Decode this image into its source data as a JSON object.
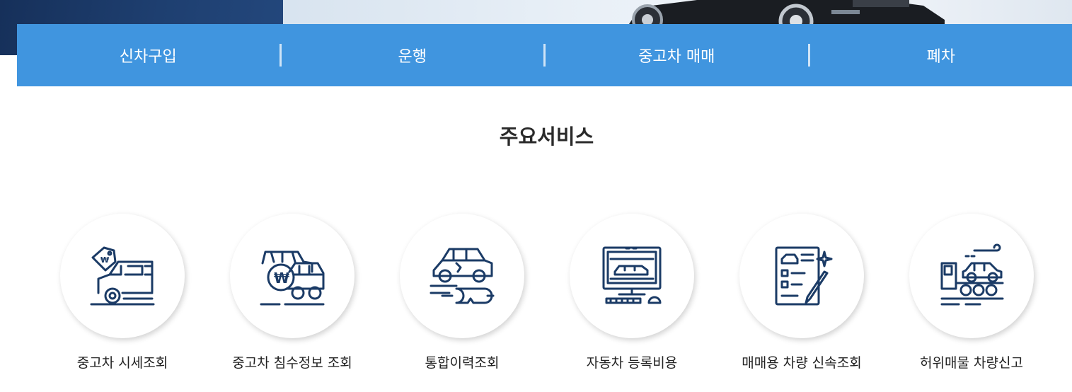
{
  "nav": {
    "items": [
      {
        "label": "신차구입"
      },
      {
        "label": "운행"
      },
      {
        "label": "중고차 매매"
      },
      {
        "label": "폐차"
      }
    ]
  },
  "section": {
    "title": "주요서비스"
  },
  "services": [
    {
      "label": "중고차 시세조회",
      "icon": "car-price-tag-icon"
    },
    {
      "label": "중고차 침수정보 조회",
      "icon": "flooded-car-won-icon"
    },
    {
      "label": "통합이력조회",
      "icon": "car-repair-history-icon"
    },
    {
      "label": "자동차 등록비용",
      "icon": "computer-car-icon"
    },
    {
      "label": "매매용 차량 신속조회",
      "icon": "document-pen-icon"
    },
    {
      "label": "허위매물 차량신고",
      "icon": "tow-truck-icon"
    }
  ],
  "colors": {
    "nav_bg": "#4095df",
    "icon": "#1b3b66",
    "hero_dark": "#1e3f70"
  }
}
